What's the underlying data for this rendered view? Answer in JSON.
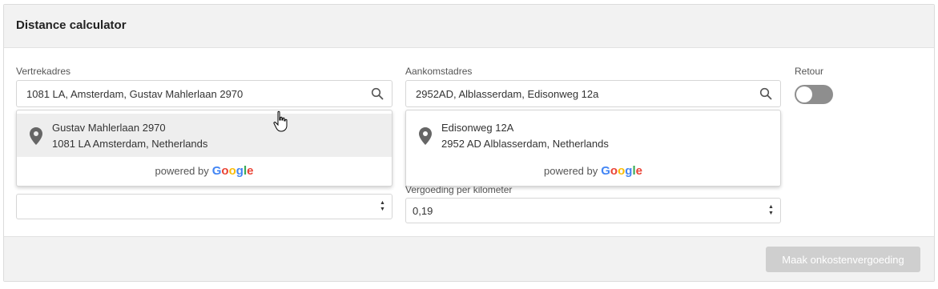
{
  "card": {
    "title": "Distance calculator"
  },
  "departure": {
    "label": "Vertrekadres",
    "value": "1081 LA, Amsterdam, Gustav Mahlerlaan 2970",
    "suggestion": {
      "line1": "Gustav Mahlerlaan 2970",
      "line2": "1081 LA Amsterdam, Netherlands"
    },
    "powered_by": "powered by",
    "brand": "Google"
  },
  "arrival": {
    "label": "Aankomstadres",
    "value": "2952AD, Alblasserdam, Edisonweg 12a",
    "suggestion": {
      "line1": "Edisonweg 12A",
      "line2": "2952 AD Alblasserdam, Netherlands"
    },
    "powered_by": "powered by",
    "brand": "Google"
  },
  "retour": {
    "label": "Retour",
    "checked": false
  },
  "distance": {
    "value": ""
  },
  "rate": {
    "label": "Vergoeding per kilometer",
    "value": "0,19"
  },
  "footer": {
    "submit_label": "Maak onkostenvergoeding"
  },
  "icons": {
    "search": "search-icon",
    "pin": "map-pin-icon",
    "spinner": "number-spinner-icon"
  },
  "colors": {
    "google_blue": "#4285F4",
    "google_red": "#EA4335",
    "google_yellow": "#FBBC05",
    "google_green": "#34A853",
    "toggle_off": "#8e8e8e",
    "button_disabled": "#cfcfcf"
  }
}
